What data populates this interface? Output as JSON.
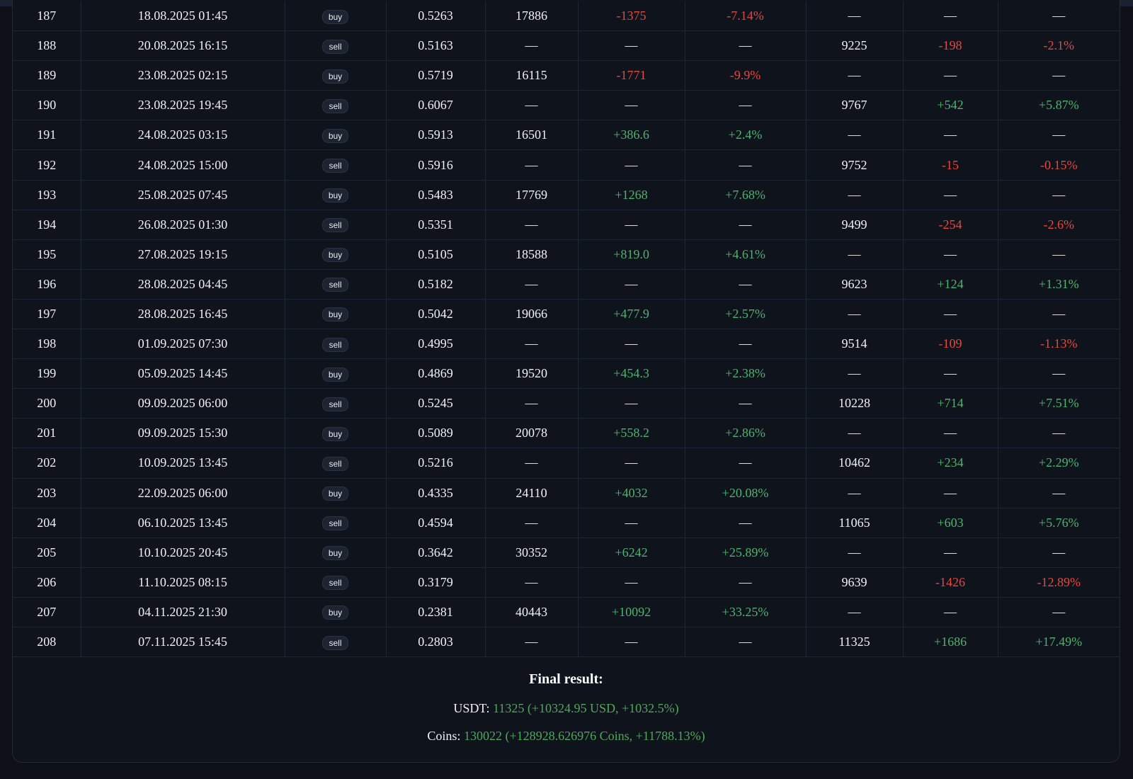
{
  "colors": {
    "background": "#0d1017",
    "panel": "#0f131c",
    "positive": "#4fb36e",
    "negative": "#e5483f",
    "final_value": "#4fa85a"
  },
  "trades": {
    "rows": [
      {
        "id": "187",
        "datetime": "18.08.2025 01:45",
        "side": "buy",
        "price": "0.5263",
        "qty": "17886",
        "pnl": "-1375",
        "pnl_pct": "-7.14%",
        "usdt": "—",
        "usdt_pnl": "—",
        "usdt_pct": "—"
      },
      {
        "id": "188",
        "datetime": "20.08.2025 16:15",
        "side": "sell",
        "price": "0.5163",
        "qty": "—",
        "pnl": "—",
        "pnl_pct": "—",
        "usdt": "9225",
        "usdt_pnl": "-198",
        "usdt_pct": "-2.1%"
      },
      {
        "id": "189",
        "datetime": "23.08.2025 02:15",
        "side": "buy",
        "price": "0.5719",
        "qty": "16115",
        "pnl": "-1771",
        "pnl_pct": "-9.9%",
        "usdt": "—",
        "usdt_pnl": "—",
        "usdt_pct": "—"
      },
      {
        "id": "190",
        "datetime": "23.08.2025 19:45",
        "side": "sell",
        "price": "0.6067",
        "qty": "—",
        "pnl": "—",
        "pnl_pct": "—",
        "usdt": "9767",
        "usdt_pnl": "+542",
        "usdt_pct": "+5.87%"
      },
      {
        "id": "191",
        "datetime": "24.08.2025 03:15",
        "side": "buy",
        "price": "0.5913",
        "qty": "16501",
        "pnl": "+386.6",
        "pnl_pct": "+2.4%",
        "usdt": "—",
        "usdt_pnl": "—",
        "usdt_pct": "—"
      },
      {
        "id": "192",
        "datetime": "24.08.2025 15:00",
        "side": "sell",
        "price": "0.5916",
        "qty": "—",
        "pnl": "—",
        "pnl_pct": "—",
        "usdt": "9752",
        "usdt_pnl": "-15",
        "usdt_pct": "-0.15%"
      },
      {
        "id": "193",
        "datetime": "25.08.2025 07:45",
        "side": "buy",
        "price": "0.5483",
        "qty": "17769",
        "pnl": "+1268",
        "pnl_pct": "+7.68%",
        "usdt": "—",
        "usdt_pnl": "—",
        "usdt_pct": "—"
      },
      {
        "id": "194",
        "datetime": "26.08.2025 01:30",
        "side": "sell",
        "price": "0.5351",
        "qty": "—",
        "pnl": "—",
        "pnl_pct": "—",
        "usdt": "9499",
        "usdt_pnl": "-254",
        "usdt_pct": "-2.6%"
      },
      {
        "id": "195",
        "datetime": "27.08.2025 19:15",
        "side": "buy",
        "price": "0.5105",
        "qty": "18588",
        "pnl": "+819.0",
        "pnl_pct": "+4.61%",
        "usdt": "—",
        "usdt_pnl": "—",
        "usdt_pct": "—"
      },
      {
        "id": "196",
        "datetime": "28.08.2025 04:45",
        "side": "sell",
        "price": "0.5182",
        "qty": "—",
        "pnl": "—",
        "pnl_pct": "—",
        "usdt": "9623",
        "usdt_pnl": "+124",
        "usdt_pct": "+1.31%"
      },
      {
        "id": "197",
        "datetime": "28.08.2025 16:45",
        "side": "buy",
        "price": "0.5042",
        "qty": "19066",
        "pnl": "+477.9",
        "pnl_pct": "+2.57%",
        "usdt": "—",
        "usdt_pnl": "—",
        "usdt_pct": "—"
      },
      {
        "id": "198",
        "datetime": "01.09.2025 07:30",
        "side": "sell",
        "price": "0.4995",
        "qty": "—",
        "pnl": "—",
        "pnl_pct": "—",
        "usdt": "9514",
        "usdt_pnl": "-109",
        "usdt_pct": "-1.13%"
      },
      {
        "id": "199",
        "datetime": "05.09.2025 14:45",
        "side": "buy",
        "price": "0.4869",
        "qty": "19520",
        "pnl": "+454.3",
        "pnl_pct": "+2.38%",
        "usdt": "—",
        "usdt_pnl": "—",
        "usdt_pct": "—"
      },
      {
        "id": "200",
        "datetime": "09.09.2025 06:00",
        "side": "sell",
        "price": "0.5245",
        "qty": "—",
        "pnl": "—",
        "pnl_pct": "—",
        "usdt": "10228",
        "usdt_pnl": "+714",
        "usdt_pct": "+7.51%"
      },
      {
        "id": "201",
        "datetime": "09.09.2025 15:30",
        "side": "buy",
        "price": "0.5089",
        "qty": "20078",
        "pnl": "+558.2",
        "pnl_pct": "+2.86%",
        "usdt": "—",
        "usdt_pnl": "—",
        "usdt_pct": "—"
      },
      {
        "id": "202",
        "datetime": "10.09.2025 13:45",
        "side": "sell",
        "price": "0.5216",
        "qty": "—",
        "pnl": "—",
        "pnl_pct": "—",
        "usdt": "10462",
        "usdt_pnl": "+234",
        "usdt_pct": "+2.29%"
      },
      {
        "id": "203",
        "datetime": "22.09.2025 06:00",
        "side": "buy",
        "price": "0.4335",
        "qty": "24110",
        "pnl": "+4032",
        "pnl_pct": "+20.08%",
        "usdt": "—",
        "usdt_pnl": "—",
        "usdt_pct": "—"
      },
      {
        "id": "204",
        "datetime": "06.10.2025 13:45",
        "side": "sell",
        "price": "0.4594",
        "qty": "—",
        "pnl": "—",
        "pnl_pct": "—",
        "usdt": "11065",
        "usdt_pnl": "+603",
        "usdt_pct": "+5.76%"
      },
      {
        "id": "205",
        "datetime": "10.10.2025 20:45",
        "side": "buy",
        "price": "0.3642",
        "qty": "30352",
        "pnl": "+6242",
        "pnl_pct": "+25.89%",
        "usdt": "—",
        "usdt_pnl": "—",
        "usdt_pct": "—"
      },
      {
        "id": "206",
        "datetime": "11.10.2025 08:15",
        "side": "sell",
        "price": "0.3179",
        "qty": "—",
        "pnl": "—",
        "pnl_pct": "—",
        "usdt": "9639",
        "usdt_pnl": "-1426",
        "usdt_pct": "-12.89%"
      },
      {
        "id": "207",
        "datetime": "04.11.2025 21:30",
        "side": "buy",
        "price": "0.2381",
        "qty": "40443",
        "pnl": "+10092",
        "pnl_pct": "+33.25%",
        "usdt": "—",
        "usdt_pnl": "—",
        "usdt_pct": "—"
      },
      {
        "id": "208",
        "datetime": "07.11.2025 15:45",
        "side": "sell",
        "price": "0.2803",
        "qty": "—",
        "pnl": "—",
        "pnl_pct": "—",
        "usdt": "11325",
        "usdt_pnl": "+1686",
        "usdt_pct": "+17.49%"
      }
    ]
  },
  "final": {
    "title": "Final result:",
    "usdt_label": "USDT:",
    "usdt_value": "11325 (+10324.95 USD, +1032.5%)",
    "coins_label": "Coins:",
    "coins_value": "130022 (+128928.626976 Coins, +11788.13%)"
  }
}
